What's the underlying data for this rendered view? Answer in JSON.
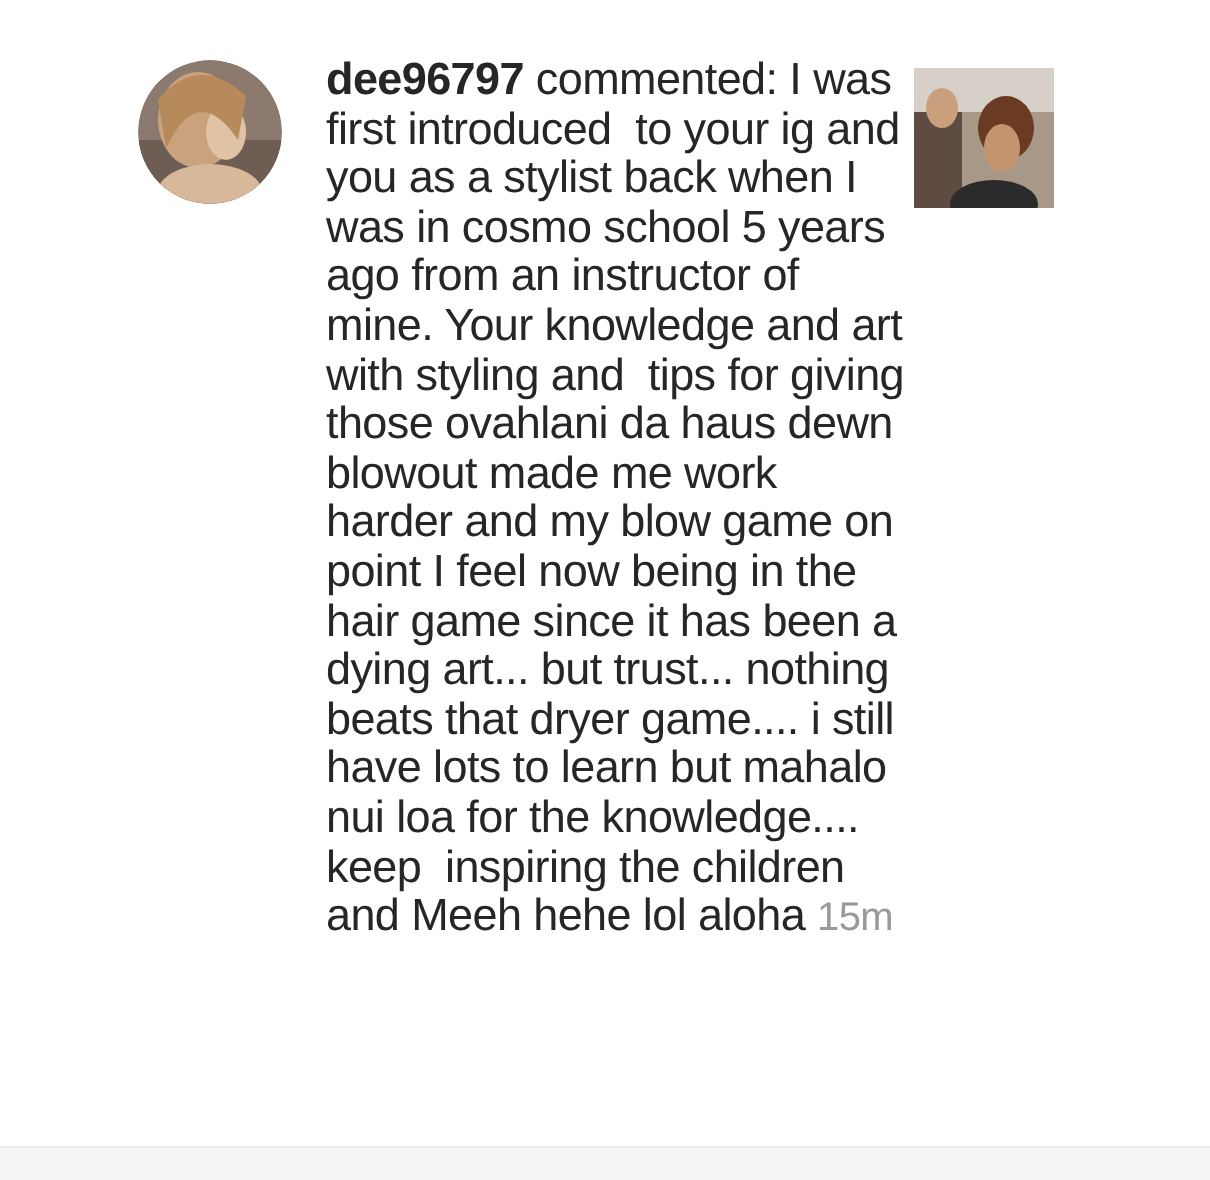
{
  "notification": {
    "comment": "**dee96797** commented: I was first introduced  to your ig and you as a stylist back when I was in cosmo school 5 years ago from an instructor of mine. Your knowledge and art with styling and  tips for giving those ovahlani da haus dewn blowout made me work harder and my blow game on point I feel now being in the hair game since it has been a dying art... but trust... nothing beats that dryer game.... i still have lots to learn but mahalo nui loa for the knowledge.... keep  inspiring the children and Meeh hehe lol aloha",
    "time": "15m"
  }
}
